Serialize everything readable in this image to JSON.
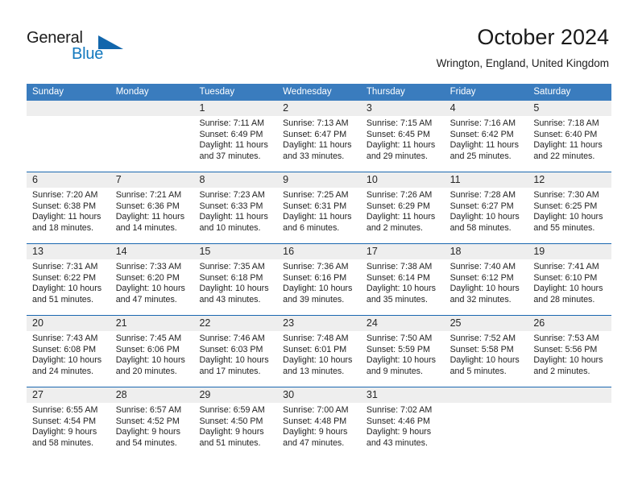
{
  "brand": {
    "name_part1": "General",
    "name_part2": "Blue",
    "accent_color": "#1278be",
    "triangle_color": "#1266ac"
  },
  "header": {
    "title": "October 2024",
    "subtitle": "Wrington, England, United Kingdom"
  },
  "calendar": {
    "header_bg": "#3a7cbe",
    "separator_color": "#1b68b0",
    "daynum_bg": "#eeeeee",
    "weekdays": [
      "Sunday",
      "Monday",
      "Tuesday",
      "Wednesday",
      "Thursday",
      "Friday",
      "Saturday"
    ],
    "weeks": [
      [
        {
          "day": "",
          "lines": []
        },
        {
          "day": "",
          "lines": []
        },
        {
          "day": "1",
          "lines": [
            "Sunrise: 7:11 AM",
            "Sunset: 6:49 PM",
            "Daylight: 11 hours",
            "and 37 minutes."
          ]
        },
        {
          "day": "2",
          "lines": [
            "Sunrise: 7:13 AM",
            "Sunset: 6:47 PM",
            "Daylight: 11 hours",
            "and 33 minutes."
          ]
        },
        {
          "day": "3",
          "lines": [
            "Sunrise: 7:15 AM",
            "Sunset: 6:45 PM",
            "Daylight: 11 hours",
            "and 29 minutes."
          ]
        },
        {
          "day": "4",
          "lines": [
            "Sunrise: 7:16 AM",
            "Sunset: 6:42 PM",
            "Daylight: 11 hours",
            "and 25 minutes."
          ]
        },
        {
          "day": "5",
          "lines": [
            "Sunrise: 7:18 AM",
            "Sunset: 6:40 PM",
            "Daylight: 11 hours",
            "and 22 minutes."
          ]
        }
      ],
      [
        {
          "day": "6",
          "lines": [
            "Sunrise: 7:20 AM",
            "Sunset: 6:38 PM",
            "Daylight: 11 hours",
            "and 18 minutes."
          ]
        },
        {
          "day": "7",
          "lines": [
            "Sunrise: 7:21 AM",
            "Sunset: 6:36 PM",
            "Daylight: 11 hours",
            "and 14 minutes."
          ]
        },
        {
          "day": "8",
          "lines": [
            "Sunrise: 7:23 AM",
            "Sunset: 6:33 PM",
            "Daylight: 11 hours",
            "and 10 minutes."
          ]
        },
        {
          "day": "9",
          "lines": [
            "Sunrise: 7:25 AM",
            "Sunset: 6:31 PM",
            "Daylight: 11 hours",
            "and 6 minutes."
          ]
        },
        {
          "day": "10",
          "lines": [
            "Sunrise: 7:26 AM",
            "Sunset: 6:29 PM",
            "Daylight: 11 hours",
            "and 2 minutes."
          ]
        },
        {
          "day": "11",
          "lines": [
            "Sunrise: 7:28 AM",
            "Sunset: 6:27 PM",
            "Daylight: 10 hours",
            "and 58 minutes."
          ]
        },
        {
          "day": "12",
          "lines": [
            "Sunrise: 7:30 AM",
            "Sunset: 6:25 PM",
            "Daylight: 10 hours",
            "and 55 minutes."
          ]
        }
      ],
      [
        {
          "day": "13",
          "lines": [
            "Sunrise: 7:31 AM",
            "Sunset: 6:22 PM",
            "Daylight: 10 hours",
            "and 51 minutes."
          ]
        },
        {
          "day": "14",
          "lines": [
            "Sunrise: 7:33 AM",
            "Sunset: 6:20 PM",
            "Daylight: 10 hours",
            "and 47 minutes."
          ]
        },
        {
          "day": "15",
          "lines": [
            "Sunrise: 7:35 AM",
            "Sunset: 6:18 PM",
            "Daylight: 10 hours",
            "and 43 minutes."
          ]
        },
        {
          "day": "16",
          "lines": [
            "Sunrise: 7:36 AM",
            "Sunset: 6:16 PM",
            "Daylight: 10 hours",
            "and 39 minutes."
          ]
        },
        {
          "day": "17",
          "lines": [
            "Sunrise: 7:38 AM",
            "Sunset: 6:14 PM",
            "Daylight: 10 hours",
            "and 35 minutes."
          ]
        },
        {
          "day": "18",
          "lines": [
            "Sunrise: 7:40 AM",
            "Sunset: 6:12 PM",
            "Daylight: 10 hours",
            "and 32 minutes."
          ]
        },
        {
          "day": "19",
          "lines": [
            "Sunrise: 7:41 AM",
            "Sunset: 6:10 PM",
            "Daylight: 10 hours",
            "and 28 minutes."
          ]
        }
      ],
      [
        {
          "day": "20",
          "lines": [
            "Sunrise: 7:43 AM",
            "Sunset: 6:08 PM",
            "Daylight: 10 hours",
            "and 24 minutes."
          ]
        },
        {
          "day": "21",
          "lines": [
            "Sunrise: 7:45 AM",
            "Sunset: 6:06 PM",
            "Daylight: 10 hours",
            "and 20 minutes."
          ]
        },
        {
          "day": "22",
          "lines": [
            "Sunrise: 7:46 AM",
            "Sunset: 6:03 PM",
            "Daylight: 10 hours",
            "and 17 minutes."
          ]
        },
        {
          "day": "23",
          "lines": [
            "Sunrise: 7:48 AM",
            "Sunset: 6:01 PM",
            "Daylight: 10 hours",
            "and 13 minutes."
          ]
        },
        {
          "day": "24",
          "lines": [
            "Sunrise: 7:50 AM",
            "Sunset: 5:59 PM",
            "Daylight: 10 hours",
            "and 9 minutes."
          ]
        },
        {
          "day": "25",
          "lines": [
            "Sunrise: 7:52 AM",
            "Sunset: 5:58 PM",
            "Daylight: 10 hours",
            "and 5 minutes."
          ]
        },
        {
          "day": "26",
          "lines": [
            "Sunrise: 7:53 AM",
            "Sunset: 5:56 PM",
            "Daylight: 10 hours",
            "and 2 minutes."
          ]
        }
      ],
      [
        {
          "day": "27",
          "lines": [
            "Sunrise: 6:55 AM",
            "Sunset: 4:54 PM",
            "Daylight: 9 hours",
            "and 58 minutes."
          ]
        },
        {
          "day": "28",
          "lines": [
            "Sunrise: 6:57 AM",
            "Sunset: 4:52 PM",
            "Daylight: 9 hours",
            "and 54 minutes."
          ]
        },
        {
          "day": "29",
          "lines": [
            "Sunrise: 6:59 AM",
            "Sunset: 4:50 PM",
            "Daylight: 9 hours",
            "and 51 minutes."
          ]
        },
        {
          "day": "30",
          "lines": [
            "Sunrise: 7:00 AM",
            "Sunset: 4:48 PM",
            "Daylight: 9 hours",
            "and 47 minutes."
          ]
        },
        {
          "day": "31",
          "lines": [
            "Sunrise: 7:02 AM",
            "Sunset: 4:46 PM",
            "Daylight: 9 hours",
            "and 43 minutes."
          ]
        },
        {
          "day": "",
          "lines": []
        },
        {
          "day": "",
          "lines": []
        }
      ]
    ]
  }
}
